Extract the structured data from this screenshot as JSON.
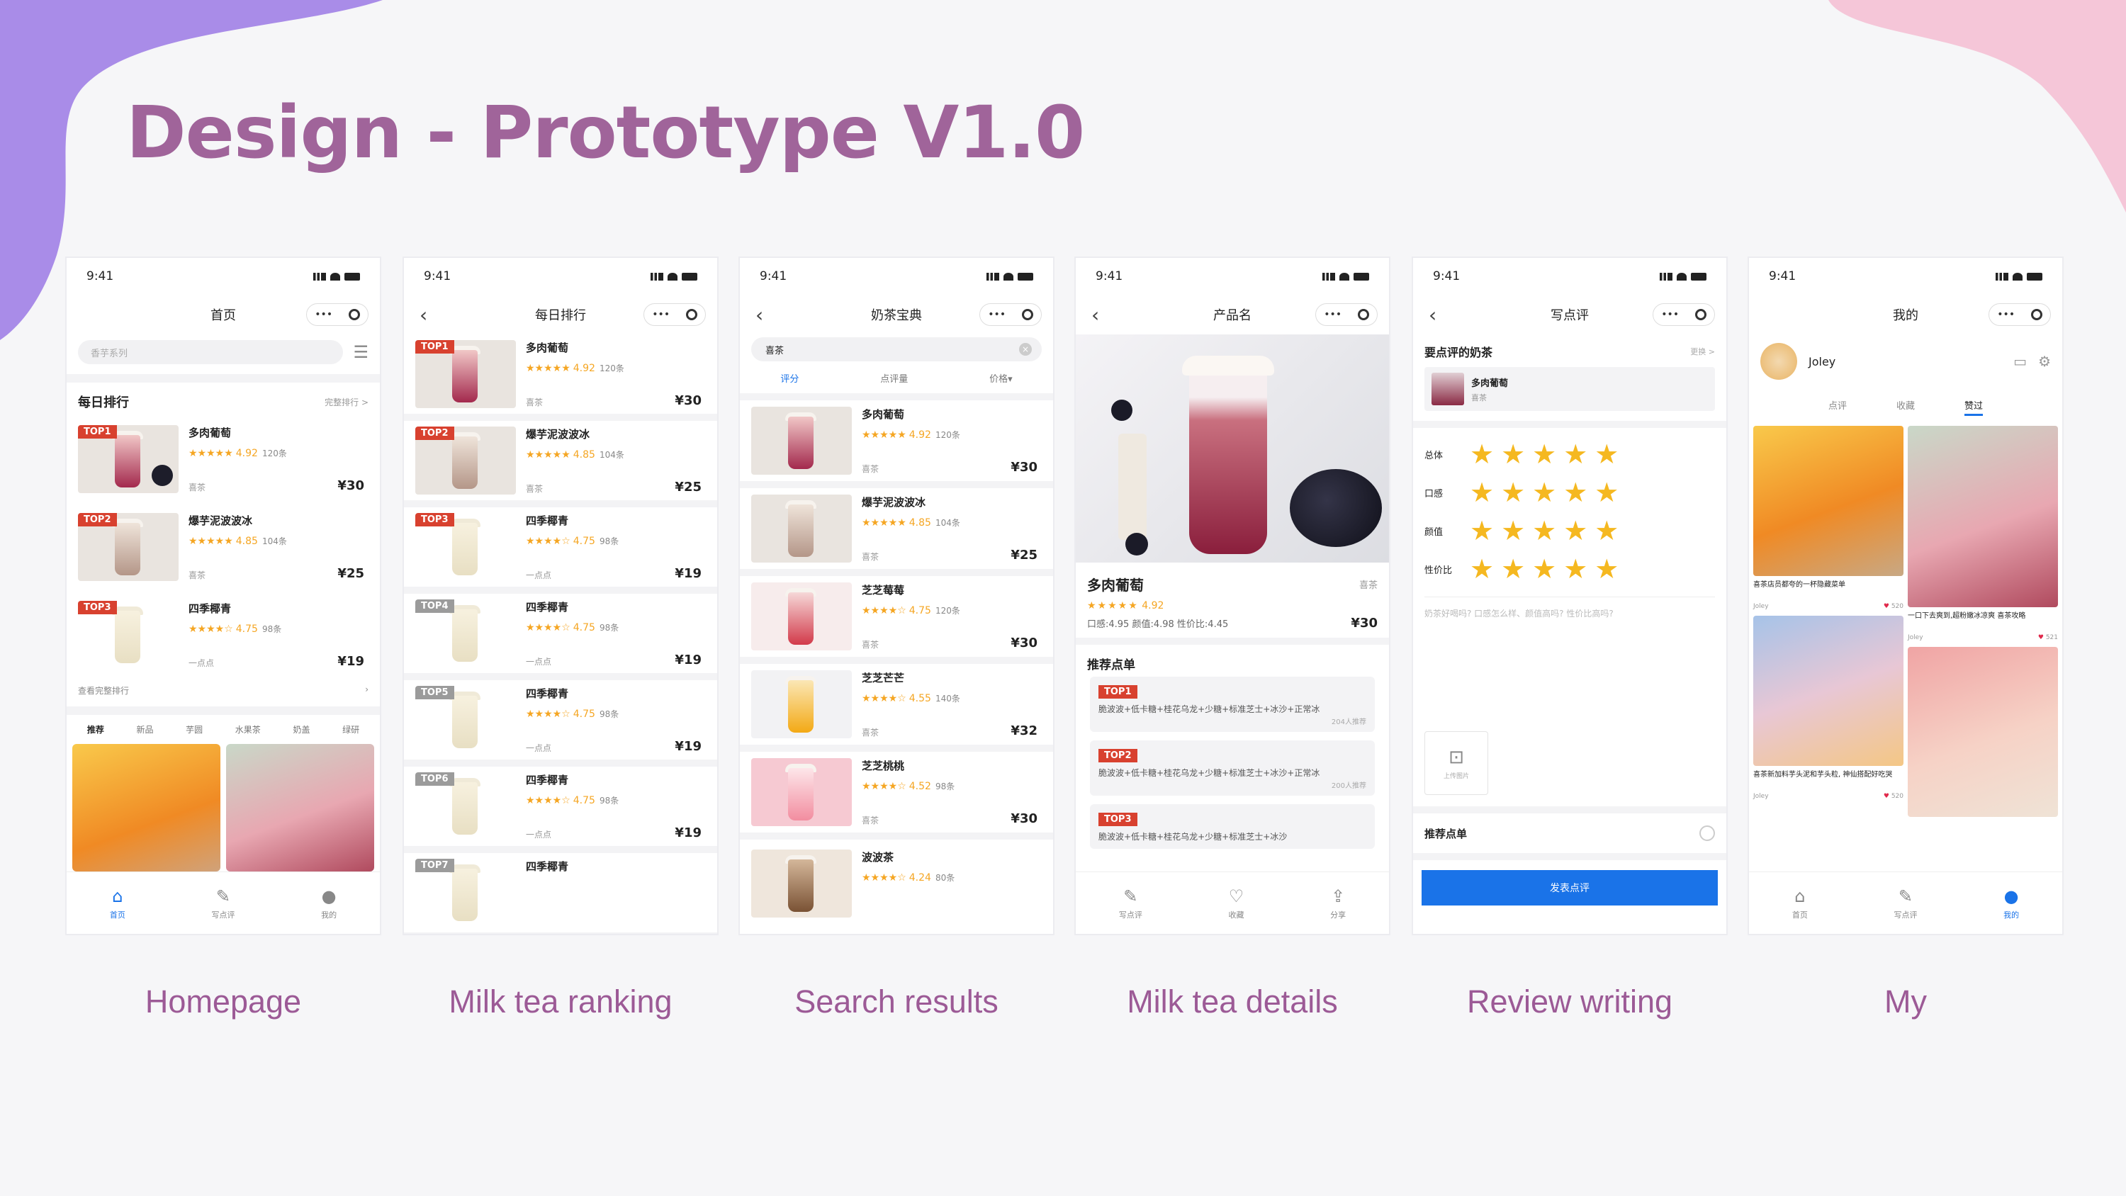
{
  "title": "Design - Prototype V1.0",
  "captions": [
    "Homepage",
    "Milk tea ranking",
    "Search results",
    "Milk tea details",
    "Review writing",
    "My"
  ],
  "colors": {
    "title": "#a0649a",
    "caption": "#9c5a96",
    "blob_left": "#a98ce8",
    "blob_right": "#f5c6d8",
    "primary": "#1a73e8",
    "badge": "#d8412f",
    "star": "#f5a623"
  },
  "time": "9:41",
  "capsule_more": "•••",
  "home": {
    "nav_title": "首页",
    "search_placeholder": "香芋系列",
    "section_title": "每日排行",
    "section_more": "完整排行 >",
    "items": [
      {
        "badge": "TOP1",
        "name": "多肉葡萄",
        "stars": "★★★★★",
        "score": "4.92",
        "count": "120条",
        "tag": "喜茶",
        "price": "¥30"
      },
      {
        "badge": "TOP2",
        "name": "爆芋泥波波冰",
        "stars": "★★★★★",
        "score": "4.85",
        "count": "104条",
        "tag": "喜茶",
        "price": "¥25"
      },
      {
        "badge": "TOP3",
        "name": "四季椰青",
        "stars": "★★★★☆",
        "score": "4.75",
        "count": "98条",
        "tag": "一点点",
        "price": "¥19"
      }
    ],
    "view_all": "查看完整排行",
    "categories": [
      "推荐",
      "新品",
      "芋圆",
      "水果茶",
      "奶盖",
      "绿研"
    ],
    "tabs": [
      {
        "icon": "home-icon",
        "label": "首页"
      },
      {
        "icon": "pen-icon",
        "label": "写点评"
      },
      {
        "icon": "user-icon",
        "label": "我的"
      }
    ]
  },
  "ranking": {
    "nav_title": "每日排行",
    "items": [
      {
        "badge": "TOP1",
        "name": "多肉葡萄",
        "stars": "★★★★★",
        "score": "4.92",
        "count": "120条",
        "tag": "喜茶",
        "price": "¥30"
      },
      {
        "badge": "TOP2",
        "name": "爆芋泥波波冰",
        "stars": "★★★★★",
        "score": "4.85",
        "count": "104条",
        "tag": "喜茶",
        "price": "¥25"
      },
      {
        "badge": "TOP3",
        "name": "四季椰青",
        "stars": "★★★★☆",
        "score": "4.75",
        "count": "98条",
        "tag": "一点点",
        "price": "¥19"
      },
      {
        "badge": "TOP4",
        "name": "四季椰青",
        "stars": "★★★★☆",
        "score": "4.75",
        "count": "98条",
        "tag": "一点点",
        "price": "¥19"
      },
      {
        "badge": "TOP5",
        "name": "四季椰青",
        "stars": "★★★★☆",
        "score": "4.75",
        "count": "98条",
        "tag": "一点点",
        "price": "¥19"
      },
      {
        "badge": "TOP6",
        "name": "四季椰青",
        "stars": "★★★★☆",
        "score": "4.75",
        "count": "98条",
        "tag": "一点点",
        "price": "¥19"
      },
      {
        "badge": "TOP7",
        "name": "四季椰青",
        "stars": "",
        "score": "",
        "count": "",
        "tag": "",
        "price": ""
      }
    ]
  },
  "search": {
    "nav_title": "奶茶宝典",
    "query": "喜茶",
    "filters": [
      "评分",
      "点评量",
      "价格▾"
    ],
    "items": [
      {
        "name": "多肉葡萄",
        "stars": "★★★★★",
        "score": "4.92",
        "count": "120条",
        "tag": "喜茶",
        "price": "¥30"
      },
      {
        "name": "爆芋泥波波冰",
        "stars": "★★★★★",
        "score": "4.85",
        "count": "104条",
        "tag": "喜茶",
        "price": "¥25"
      },
      {
        "name": "芝芝莓莓",
        "stars": "★★★★☆",
        "score": "4.75",
        "count": "120条",
        "tag": "喜茶",
        "price": "¥30"
      },
      {
        "name": "芝芝芒芒",
        "stars": "★★★★☆",
        "score": "4.55",
        "count": "140条",
        "tag": "喜茶",
        "price": "¥32"
      },
      {
        "name": "芝芝桃桃",
        "stars": "★★★★☆",
        "score": "4.52",
        "count": "98条",
        "tag": "喜茶",
        "price": "¥30"
      },
      {
        "name": "波波茶",
        "stars": "★★★★☆",
        "score": "4.24",
        "count": "80条",
        "tag": "",
        "price": ""
      }
    ]
  },
  "details": {
    "nav_title": "产品名",
    "name": "多肉葡萄",
    "brand": "喜茶",
    "stars": "★★★★★",
    "score": "4.92",
    "sub_scores": "口感:4.95  颜值:4.98  性价比:4.45",
    "price": "¥30",
    "recommend_title": "推荐点单",
    "orders": [
      {
        "badge": "TOP1",
        "text": "脆波波+低卡糖+桂花乌龙+少糖+标准芝士+冰沙+正常冰",
        "count": "204人推荐"
      },
      {
        "badge": "TOP2",
        "text": "脆波波+低卡糖+桂花乌龙+少糖+标准芝士+冰沙+正常冰",
        "count": "200人推荐"
      },
      {
        "badge": "TOP3",
        "text": "脆波波+低卡糖+桂花乌龙+少糖+标准芝士+冰沙",
        "count": ""
      }
    ],
    "tabs": [
      {
        "icon": "pen-icon",
        "label": "写点评"
      },
      {
        "icon": "heart-icon",
        "label": "收藏"
      },
      {
        "icon": "share-icon",
        "label": "分享"
      }
    ]
  },
  "review": {
    "nav_title": "写点评",
    "section_title": "要点评的奶茶",
    "change": "更换 >",
    "product_name": "多肉葡萄",
    "product_brand": "喜茶",
    "rating_labels": [
      "总体",
      "口感",
      "颜值",
      "性价比"
    ],
    "stars": "★★★★★",
    "placeholder": "奶茶好喝吗? 口感怎么样、颜值高吗? 性价比高吗?",
    "upload_label": "上传图片",
    "recommend_label": "推荐点单",
    "submit": "发表点评"
  },
  "my": {
    "nav_title": "我的",
    "username": "Joley",
    "tabs": [
      "点评",
      "收藏",
      "赞过"
    ],
    "cards": [
      {
        "caption": "喜茶店员都夸的一杯隐藏菜单",
        "user": "Joley",
        "likes": "520"
      },
      {
        "caption": "一口下去爽到,超粉嫩冰凉爽 喜茶攻略",
        "user": "Joley",
        "likes": "521"
      },
      {
        "caption": "喜茶新加料芋头泥和芋头粒, 神仙搭配好吃哭",
        "user": "Joley",
        "likes": "520"
      }
    ],
    "bottom_tabs": [
      {
        "icon": "home-icon",
        "label": "首页"
      },
      {
        "icon": "pen-icon",
        "label": "写点评"
      },
      {
        "icon": "user-icon",
        "label": "我的"
      }
    ]
  }
}
